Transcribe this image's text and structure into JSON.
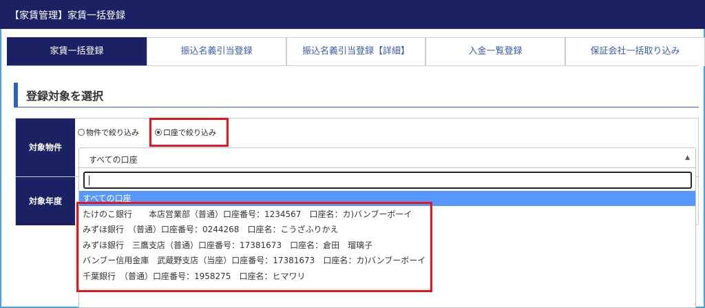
{
  "header": {
    "title": "【家賃管理】家賃一括登録"
  },
  "tabs": [
    {
      "label": "家賃一括登録",
      "active": true
    },
    {
      "label": "振込名義引当登録",
      "active": false
    },
    {
      "label": "振込名義引当登録【詳細】",
      "active": false
    },
    {
      "label": "入金一覧登録",
      "active": false
    },
    {
      "label": "保証会社一括取り込み",
      "active": false
    }
  ],
  "section": {
    "title": "登録対象を選択"
  },
  "form": {
    "row1_label": "対象物件",
    "row2_label": "対象年度",
    "filter_options": [
      {
        "label": "物件で絞り込み",
        "checked": false
      },
      {
        "label": "口座で絞り込み",
        "checked": true
      }
    ],
    "select_value": "すべての口座",
    "dropdown": {
      "search_value": "",
      "items": [
        {
          "text": "すべての口座",
          "selected": true
        },
        {
          "text": "たけのこ銀行　　本店営業部（普通）口座番号：1234567　口座名：カ)バンブーボーイ",
          "selected": false
        },
        {
          "text": "みずほ銀行　（普通）口座番号：0244268　口座名：こうざふりかえ",
          "selected": false
        },
        {
          "text": "みずほ銀行　三鷹支店（普通）口座番号：17381673　口座名：倉田　瑠璃子",
          "selected": false
        },
        {
          "text": "バンブー信用金庫　武蔵野支店（当座）口座番号：17381673　口座名：カ)バンブーボーイ",
          "selected": false
        },
        {
          "text": "千葉銀行　（普通）口座番号：1958275　口座名：ヒマワリ",
          "selected": false
        }
      ]
    }
  },
  "colors": {
    "header_bg": "#1c2163",
    "highlight": "#e8141c",
    "selected_item": "#5897fb",
    "accent_blue": "#2b64b8"
  }
}
